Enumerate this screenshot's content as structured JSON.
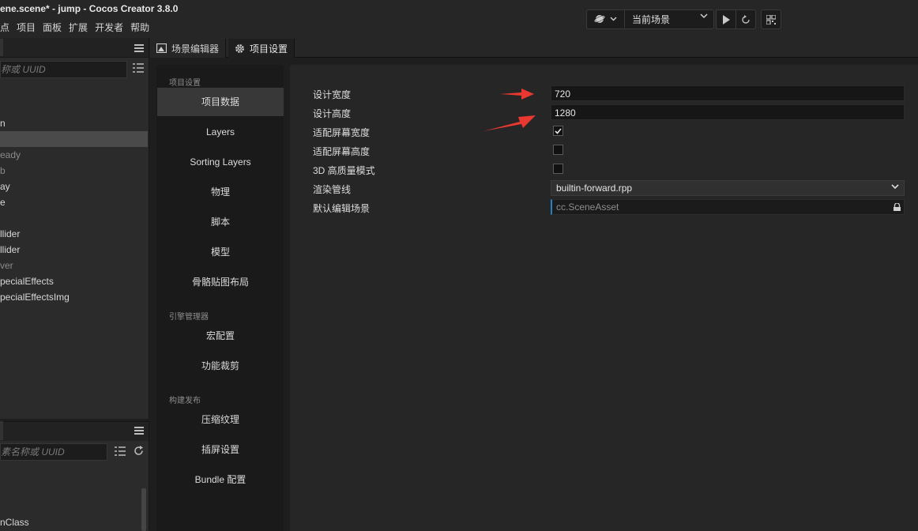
{
  "window": {
    "title": "ene.scene* - jump - Cocos Creator 3.8.0"
  },
  "menu": [
    "点",
    "项目",
    "面板",
    "扩展",
    "开发者",
    "帮助"
  ],
  "toolbar": {
    "scene_select_value": "当前场景",
    "globe_icon": "globe-icon",
    "play_icon": "play-icon",
    "refresh_icon": "refresh-icon",
    "qr_icon": "qrcode-icon"
  },
  "hierarchy": {
    "search_placeholder": "称或 UUID",
    "items": [
      {
        "label": "n",
        "dim": false,
        "selected": false
      },
      {
        "label": "",
        "dim": false,
        "selected": true
      },
      {
        "label": "eady",
        "dim": true,
        "selected": false
      },
      {
        "label": "b",
        "dim": true,
        "selected": false
      },
      {
        "label": "ay",
        "dim": false,
        "selected": false
      },
      {
        "label": "e",
        "dim": false,
        "selected": false
      },
      {
        "label": "",
        "dim": false,
        "selected": false
      },
      {
        "label": "llider",
        "dim": false,
        "selected": false
      },
      {
        "label": "llider",
        "dim": false,
        "selected": false
      },
      {
        "label": "ver",
        "dim": true,
        "selected": false
      },
      {
        "label": "pecialEffects",
        "dim": false,
        "selected": false
      },
      {
        "label": "pecialEffectsImg",
        "dim": false,
        "selected": false
      }
    ]
  },
  "assets": {
    "search_placeholder": "素名称或 UUID",
    "items": [
      "nClass"
    ]
  },
  "tabs": {
    "scene_editor": "场景编辑器",
    "project_settings": "项目设置"
  },
  "settings_nav": {
    "groups": [
      {
        "title": "项目设置",
        "items": [
          "项目数据",
          "Layers",
          "Sorting Layers",
          "物理",
          "脚本",
          "模型",
          "骨骼贴图布局"
        ]
      },
      {
        "title": "引擎管理器",
        "items": [
          "宏配置",
          "功能裁剪"
        ]
      },
      {
        "title": "构建发布",
        "items": [
          "压缩纹理",
          "插屏设置",
          "Bundle 配置"
        ]
      }
    ],
    "active": "项目数据"
  },
  "project_data": {
    "design_width": {
      "label": "设计宽度",
      "value": "720"
    },
    "design_height": {
      "label": "设计高度",
      "value": "1280"
    },
    "fit_width": {
      "label": "适配屏幕宽度",
      "checked": true
    },
    "fit_height": {
      "label": "适配屏幕高度",
      "checked": false
    },
    "hq_3d": {
      "label": "3D 高质量模式",
      "checked": false
    },
    "render_pipeline": {
      "label": "渲染管线",
      "value": "builtin-forward.rpp"
    },
    "default_scene": {
      "label": "默认编辑场景",
      "value": "cc.SceneAsset"
    }
  },
  "colors": {
    "accent": "#2c7fbf",
    "arrow": "#e8382f",
    "panel_bg": "#262626",
    "nav_bg": "#1a1a1a"
  }
}
